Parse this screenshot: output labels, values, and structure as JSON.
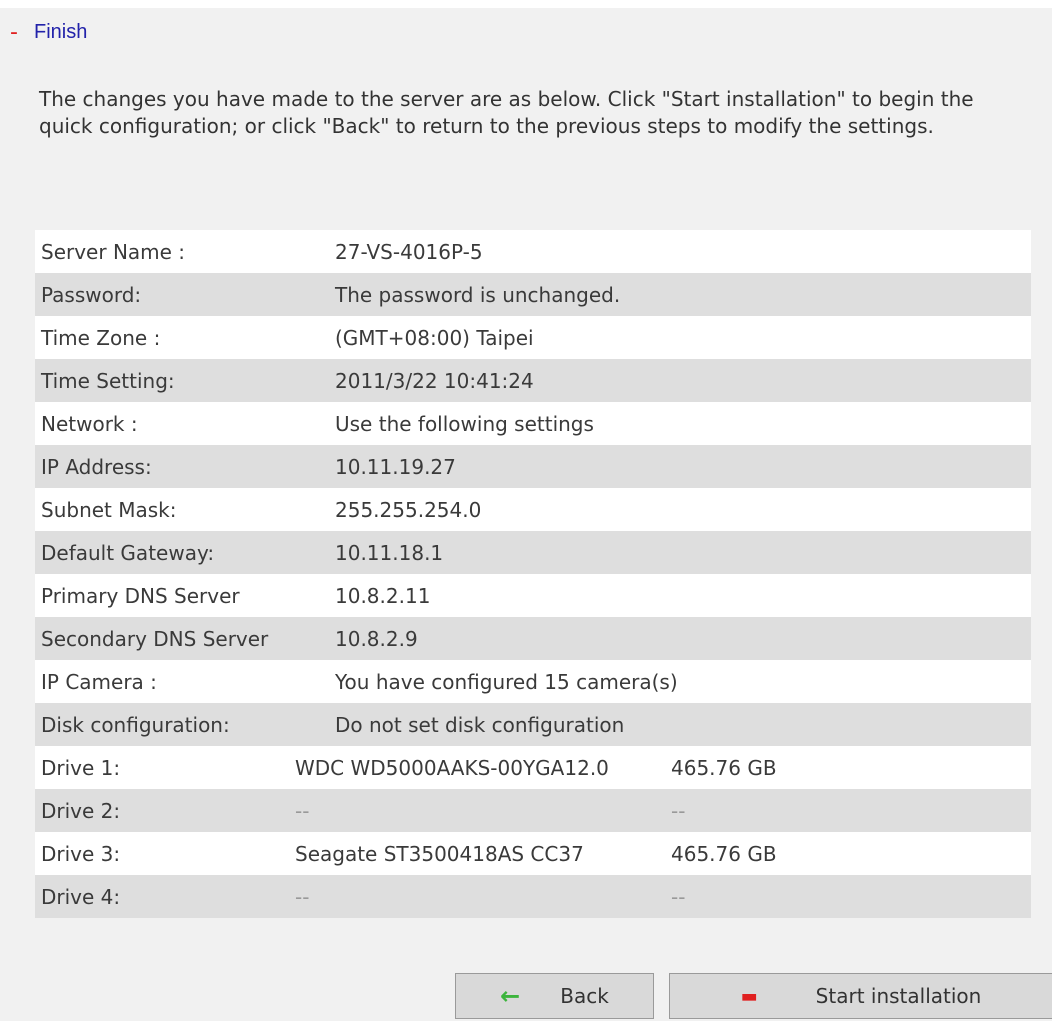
{
  "step": {
    "marker": "-",
    "title": "Finish"
  },
  "intro": "The changes you have made to the server are as below. Click \"Start installation\" to begin the quick configuration; or click \"Back\" to return to the previous steps to modify the settings.",
  "summary": [
    {
      "label": "Server Name :",
      "value": "27-VS-4016P-5"
    },
    {
      "label": "Password:",
      "value": "The password is unchanged."
    },
    {
      "label": "Time Zone :",
      "value": "(GMT+08:00) Taipei"
    },
    {
      "label": "Time Setting:",
      "value": "2011/3/22 10:41:24"
    },
    {
      "label": "Network :",
      "value": "Use the following settings"
    },
    {
      "label": "IP Address:",
      "value": "10.11.19.27"
    },
    {
      "label": "Subnet Mask:",
      "value": "255.255.254.0"
    },
    {
      "label": "Default Gateway:",
      "value": "10.11.18.1"
    },
    {
      "label": "Primary DNS Server",
      "value": "10.8.2.11"
    },
    {
      "label": "Secondary DNS Server",
      "value": "10.8.2.9"
    },
    {
      "label": "IP Camera :",
      "value": "You have configured 15 camera(s)"
    },
    {
      "label": "Disk configuration:",
      "value": "Do not set disk configuration"
    }
  ],
  "drives": [
    {
      "label": "Drive 1:",
      "model": "WDC WD5000AAKS-00YGA12.0",
      "size": "465.76 GB"
    },
    {
      "label": "Drive 2:",
      "model": "--",
      "size": "--"
    },
    {
      "label": "Drive 3:",
      "model": "Seagate ST3500418AS CC37",
      "size": "465.76 GB"
    },
    {
      "label": "Drive 4:",
      "model": "--",
      "size": "--"
    }
  ],
  "buttons": {
    "back_label": "Back",
    "back_icon": "left-arrow-icon",
    "start_label": "Start installation",
    "start_icon": "stop-icon"
  },
  "colors": {
    "title": "#2222aa",
    "marker": "#e02020",
    "row_alt": "#dedede",
    "arrow": "#3cb43c"
  }
}
